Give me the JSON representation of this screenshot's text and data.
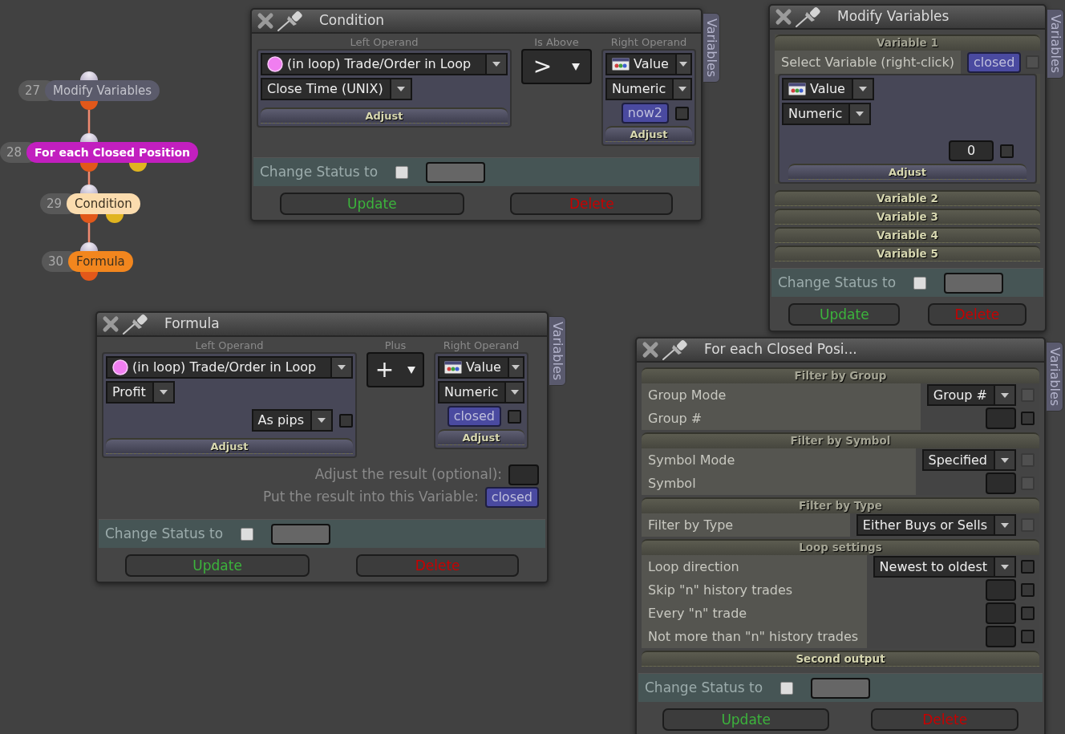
{
  "nodes": [
    {
      "number": "27",
      "label": "Modify Variables",
      "color": "#5b5b6b",
      "selected": false,
      "second_output": false
    },
    {
      "number": "28",
      "label": "For each Closed Position",
      "color": "#c21fbf",
      "selected": true,
      "second_output": true
    },
    {
      "number": "29",
      "label": "Condition",
      "color": "#fbdcae",
      "selected": false,
      "second_output": true
    },
    {
      "number": "30",
      "label": "Formula",
      "color": "#f2861e",
      "selected": false,
      "second_output": false
    }
  ],
  "windows": [
    {
      "kind": "condition",
      "title": "Condition",
      "side_tab": "Variables",
      "left_operand": {
        "label": "Left Operand",
        "source": {
          "kind": "loop",
          "text": "(in loop) Trade/Order in Loop"
        },
        "property": "Close Time (UNIX)",
        "adjust": "Adjust"
      },
      "operator": {
        "label": "Is Above",
        "symbol": ">"
      },
      "right_operand": {
        "label": "Right Operand",
        "source": {
          "kind": "value",
          "text": "Value"
        },
        "type": "Numeric",
        "value": {
          "text": "now2",
          "variable": true
        },
        "checkbox": {
          "checked": false,
          "disabled": false
        },
        "adjust": "Adjust"
      },
      "status": {
        "label": "Change Status to",
        "checked": false
      },
      "buttons": [
        {
          "label": "Update",
          "kind": "update"
        },
        {
          "label": "Delete",
          "kind": "delete"
        }
      ]
    },
    {
      "kind": "modify_variables",
      "title": "Modify Variables",
      "side_tab": "Variables",
      "variables": [
        {
          "title": "Variable 1",
          "expanded": true,
          "select_label": "Select Variable (right-click)",
          "variable": {
            "text": "closed",
            "variable": true
          },
          "variable_checkbox": {
            "checked": false,
            "disabled": true
          },
          "source": {
            "kind": "value",
            "text": "Value"
          },
          "type": "Numeric",
          "value": {
            "text": "0",
            "variable": false
          },
          "checkbox": {
            "checked": false,
            "disabled": false
          },
          "adjust": "Adjust"
        },
        {
          "title": "Variable 2",
          "expanded": false
        },
        {
          "title": "Variable 3",
          "expanded": false
        },
        {
          "title": "Variable 4",
          "expanded": false
        },
        {
          "title": "Variable 5",
          "expanded": false
        }
      ],
      "status": {
        "label": "Change Status to",
        "checked": false
      },
      "buttons": [
        {
          "label": "Update",
          "kind": "update"
        },
        {
          "label": "Delete",
          "kind": "delete"
        }
      ]
    },
    {
      "kind": "formula",
      "title": "Formula",
      "side_tab": "Variables",
      "left_operand": {
        "label": "Left Operand",
        "source": {
          "kind": "loop",
          "text": "(in loop) Trade/Order in Loop"
        },
        "property": "Profit",
        "option": {
          "text": "As pips",
          "checkbox": {
            "checked": false,
            "disabled": false
          }
        },
        "adjust": "Adjust"
      },
      "operator": {
        "label": "Plus",
        "symbol": "+"
      },
      "right_operand": {
        "label": "Right Operand",
        "source": {
          "kind": "value",
          "text": "Value"
        },
        "type": "Numeric",
        "value": {
          "text": "closed",
          "variable": true
        },
        "checkbox": {
          "checked": false,
          "disabled": false
        },
        "adjust": "Adjust"
      },
      "results": [
        {
          "label": "Adjust the result (optional):"
        },
        {
          "label": "Put the result into this Variable:",
          "value": {
            "text": "closed",
            "variable": true
          }
        }
      ],
      "status": {
        "label": "Change Status to",
        "checked": false
      },
      "buttons": [
        {
          "label": "Update",
          "kind": "update"
        },
        {
          "label": "Delete",
          "kind": "delete"
        }
      ]
    },
    {
      "kind": "loop",
      "title": "For each Closed Posi...",
      "side_tab": "Variables",
      "sections": [
        {
          "title": "Filter by Group",
          "expanded": true,
          "rows": [
            {
              "kind": "dropdown",
              "label": "Group Mode",
              "value": "Group #",
              "checkbox": {
                "checked": false,
                "disabled": true
              }
            },
            {
              "kind": "field",
              "label": "Group #",
              "checkbox": {
                "checked": false,
                "disabled": false
              }
            }
          ]
        },
        {
          "title": "Filter by Symbol",
          "expanded": true,
          "rows": [
            {
              "kind": "dropdown",
              "label": "Symbol Mode",
              "value": "Specified",
              "checkbox": {
                "checked": false,
                "disabled": true
              }
            },
            {
              "kind": "field",
              "label": "Symbol",
              "checkbox": {
                "checked": false,
                "disabled": true
              }
            }
          ]
        },
        {
          "title": "Filter by Type",
          "expanded": true,
          "rows": [
            {
              "kind": "dropdown",
              "label": "Filter by Type",
              "value": "Either Buys or Sells",
              "checkbox": {
                "checked": false,
                "disabled": true
              }
            }
          ]
        },
        {
          "title": "Loop settings",
          "expanded": true,
          "rows": [
            {
              "kind": "dropdown",
              "label": "Loop direction",
              "value": "Newest to oldest",
              "checkbox": {
                "checked": false,
                "disabled": false
              }
            },
            {
              "kind": "field",
              "label": "Skip \"n\" history trades",
              "checkbox": {
                "checked": false,
                "disabled": false
              }
            },
            {
              "kind": "field",
              "label": "Every \"n\" trade",
              "checkbox": {
                "checked": false,
                "disabled": false
              }
            },
            {
              "kind": "field",
              "label": "Not more than \"n\" history trades",
              "checkbox": {
                "checked": false,
                "disabled": false
              }
            }
          ]
        },
        {
          "title": "Second output",
          "expanded": false
        }
      ],
      "status": {
        "label": "Change Status to",
        "checked": false
      },
      "buttons": [
        {
          "label": "Update",
          "kind": "update"
        },
        {
          "label": "Delete",
          "kind": "delete"
        }
      ]
    }
  ]
}
